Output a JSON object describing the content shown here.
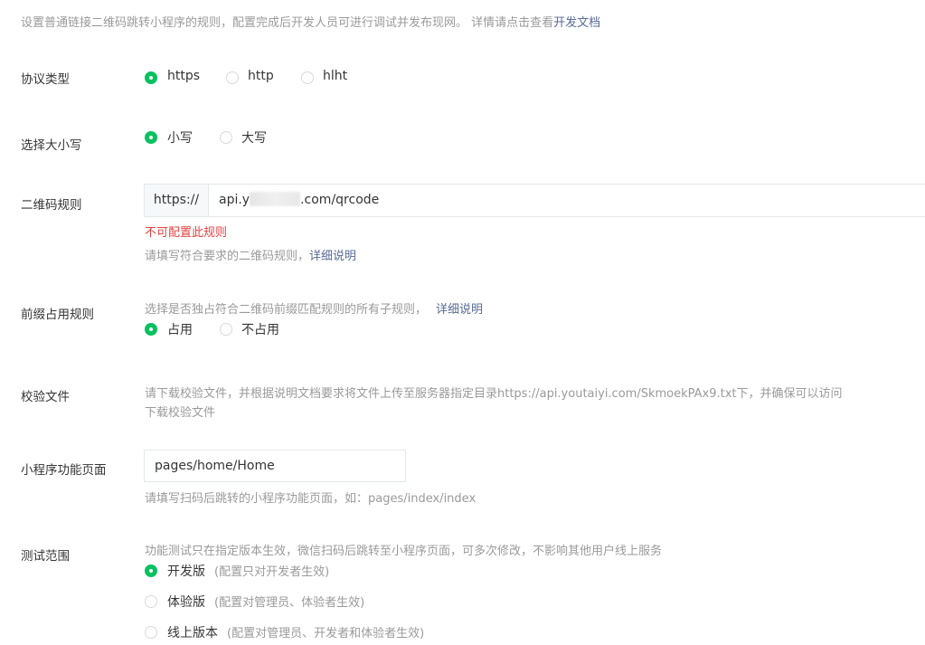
{
  "intro": {
    "text": "设置普通链接二维码跳转小程序的规则，配置完成后开发人员可进行调试并发布现网。 详情请点击查看",
    "link": "开发文档"
  },
  "protocol": {
    "label": "协议类型",
    "options": [
      "https",
      "http",
      "hlht"
    ],
    "selected": "https"
  },
  "case": {
    "label": "选择大小写",
    "options": [
      "小写",
      "大写"
    ],
    "selected": "小写"
  },
  "qrcode_rule": {
    "label": "二维码规则",
    "prefix": "https://",
    "value_start": "api.y",
    "value_end": ".com/qrcode",
    "error": "不可配置此规则",
    "hint": "请填写符合要求的二维码规则，",
    "hint_link": "详细说明"
  },
  "prefix_rule": {
    "label": "前缀占用规则",
    "desc": "选择是否独占符合二维码前缀匹配规则的所有子规则，",
    "desc_link": "详细说明",
    "options": [
      "占用",
      "不占用"
    ],
    "selected": "占用"
  },
  "verify_file": {
    "label": "校验文件",
    "desc": "请下载校验文件，并根据说明文档要求将文件上传至服务器指定目录https://api.youtaiyi.com/SkmoekPAx9.txt下，并确保可以访问",
    "download_link": "下载校验文件"
  },
  "page": {
    "label": "小程序功能页面",
    "value": "pages/home/Home",
    "hint": "请填写扫码后跳转的小程序功能页面，如：pages/index/index"
  },
  "test_scope": {
    "label": "测试范围",
    "desc": "功能测试只在指定版本生效，微信扫码后跳转至小程序页面，可多次修改，不影响其他用户线上服务",
    "options": [
      {
        "name": "开发版",
        "note": "(配置只对开发者生效)"
      },
      {
        "name": "体验版",
        "note": "(配置对管理员、体验者生效)"
      },
      {
        "name": "线上版本",
        "note": "(配置对管理员、开发者和体验者生效)"
      }
    ],
    "selected": "开发版"
  },
  "colors": {
    "accent": "#07c160",
    "link": "#576b95",
    "error": "#e64340",
    "muted": "#9a9a9a"
  }
}
